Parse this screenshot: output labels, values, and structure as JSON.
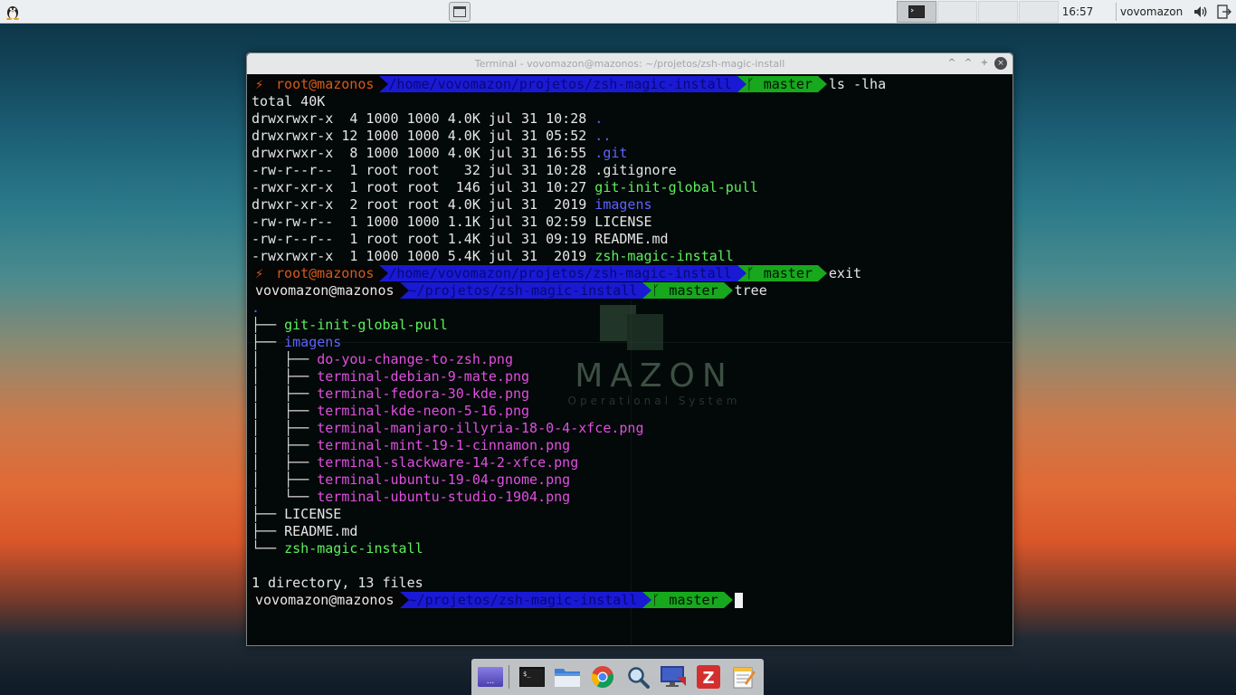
{
  "top_panel": {
    "menu_icon": "tux-penguin-icon",
    "show_desktop_icon": "window-icon",
    "workspaces": [
      {
        "icon": "terminal-icon",
        "active": true
      },
      {
        "icon": "",
        "active": false
      },
      {
        "icon": "",
        "active": false
      },
      {
        "icon": "",
        "active": false
      }
    ],
    "clock": "16:57",
    "user": "vovomazon",
    "volume_icon": "volume-icon",
    "logout_icon": "logout-icon"
  },
  "terminal": {
    "title": "Terminal - vovomazon@mazonos: ~/projetos/zsh-magic-install",
    "buttons": {
      "minimize": "^",
      "maximize": "^",
      "restore": "+",
      "close": "×"
    },
    "prompts": [
      {
        "symbol": "⚡",
        "host": "root@mazonos",
        "path": "/home/vovomazon/projetos/zsh-magic-install",
        "branch_icon": "ᚴ",
        "branch": "master",
        "command": "ls -lha"
      },
      {
        "symbol": "⚡",
        "host": "root@mazonos",
        "path": "/home/vovomazon/projetos/zsh-magic-install",
        "branch_icon": "ᚴ",
        "branch": "master",
        "command": "exit"
      },
      {
        "symbol": "",
        "host": "vovomazon@mazonos",
        "path": "~/projetos/zsh-magic-install",
        "branch_icon": "ᚴ",
        "branch": "master",
        "command": "tree"
      },
      {
        "symbol": "",
        "host": "vovomazon@mazonos",
        "path": "~/projetos/zsh-magic-install",
        "branch_icon": "ᚴ",
        "branch": "master",
        "command": ""
      }
    ],
    "ls_total": "total 40K",
    "ls_rows": [
      {
        "meta": "drwxrwxr-x  4 1000 1000 4.0K jul 31 10:28 ",
        "name": ".",
        "color": "blue"
      },
      {
        "meta": "drwxrwxr-x 12 1000 1000 4.0K jul 31 05:52 ",
        "name": "..",
        "color": "blue"
      },
      {
        "meta": "drwxrwxr-x  8 1000 1000 4.0K jul 31 16:55 ",
        "name": ".git",
        "color": "blue"
      },
      {
        "meta": "-rw-r--r--  1 root root   32 jul 31 10:28 ",
        "name": ".gitignore",
        "color": "white"
      },
      {
        "meta": "-rwxr-xr-x  1 root root  146 jul 31 10:27 ",
        "name": "git-init-global-pull",
        "color": "green"
      },
      {
        "meta": "drwxr-xr-x  2 root root 4.0K jul 31  2019 ",
        "name": "imagens",
        "color": "blue"
      },
      {
        "meta": "-rw-rw-r--  1 1000 1000 1.1K jul 31 02:59 ",
        "name": "LICENSE",
        "color": "white"
      },
      {
        "meta": "-rw-r--r--  1 root root 1.4K jul 31 09:19 ",
        "name": "README.md",
        "color": "white"
      },
      {
        "meta": "-rwxrwxr-x  1 1000 1000 5.4K jul 31  2019 ",
        "name": "zsh-magic-install",
        "color": "green"
      }
    ],
    "tree_root": ".",
    "tree_rows": [
      {
        "prefix": "├── ",
        "name": "git-init-global-pull",
        "color": "green"
      },
      {
        "prefix": "├── ",
        "name": "imagens",
        "color": "blue"
      },
      {
        "prefix": "│   ├── ",
        "name": "do-you-change-to-zsh.png",
        "color": "magenta"
      },
      {
        "prefix": "│   ├── ",
        "name": "terminal-debian-9-mate.png",
        "color": "magenta"
      },
      {
        "prefix": "│   ├── ",
        "name": "terminal-fedora-30-kde.png",
        "color": "magenta"
      },
      {
        "prefix": "│   ├── ",
        "name": "terminal-kde-neon-5-16.png",
        "color": "magenta"
      },
      {
        "prefix": "│   ├── ",
        "name": "terminal-manjaro-illyria-18-0-4-xfce.png",
        "color": "magenta"
      },
      {
        "prefix": "│   ├── ",
        "name": "terminal-mint-19-1-cinnamon.png",
        "color": "magenta"
      },
      {
        "prefix": "│   ├── ",
        "name": "terminal-slackware-14-2-xfce.png",
        "color": "magenta"
      },
      {
        "prefix": "│   ├── ",
        "name": "terminal-ubuntu-19-04-gnome.png",
        "color": "magenta"
      },
      {
        "prefix": "│   └── ",
        "name": "terminal-ubuntu-studio-1904.png",
        "color": "magenta"
      },
      {
        "prefix": "├── ",
        "name": "LICENSE",
        "color": "white"
      },
      {
        "prefix": "├── ",
        "name": "README.md",
        "color": "white"
      },
      {
        "prefix": "└── ",
        "name": "zsh-magic-install",
        "color": "green"
      }
    ],
    "tree_summary": "1 directory, 13 files",
    "watermark": {
      "brand": "MAZON",
      "tagline": "Operational System"
    }
  },
  "dock": {
    "items": [
      {
        "name": "show-desktop-icon"
      },
      {
        "name": "terminal-icon"
      },
      {
        "name": "file-manager-icon"
      },
      {
        "name": "chrome-icon"
      },
      {
        "name": "search-icon"
      },
      {
        "name": "remote-desktop-icon"
      },
      {
        "name": "filezilla-icon",
        "label": "Z"
      },
      {
        "name": "text-editor-icon"
      }
    ]
  },
  "colors": {
    "prompt_path_bg": "#1a1ad4",
    "prompt_branch_bg": "#17a81d",
    "root_host": "#d55a1a",
    "dir_blue": "#5d63ff",
    "exec_green": "#5df05d",
    "image_magenta": "#e04fe0"
  }
}
